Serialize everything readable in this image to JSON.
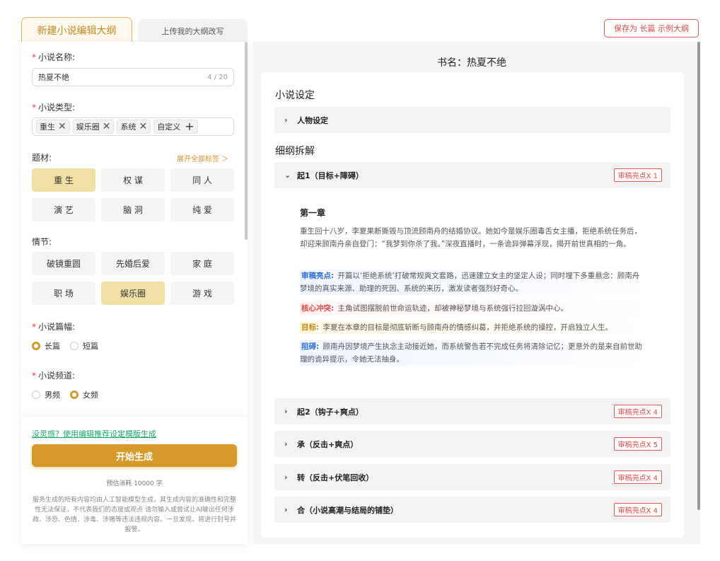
{
  "tabs": {
    "new": "新建小说编辑大纲",
    "upload": "上传我的大纲改写"
  },
  "save_button": "保存为 长篇 示例大纲",
  "form": {
    "name_label": "小说名称:",
    "name_value": "热夏不绝",
    "name_count": "4 / 20",
    "type_label": "小说类型:",
    "type_tags": [
      "重生",
      "娱乐圈",
      "系统"
    ],
    "custom_tag": "自定义",
    "theme_label": "题材:",
    "expand_label": "展开全部标签 ＞",
    "themes": [
      "重 生",
      "权 谋",
      "同 人",
      "演 艺",
      "脑 洞",
      "纯 爱"
    ],
    "plot_label": "情节:",
    "plots": [
      "破镜重圆",
      "先婚后爱",
      "家 庭",
      "职 场",
      "娱乐圈",
      "游 戏"
    ],
    "length_label": "小说篇幅:",
    "length_options": [
      "长篇",
      "短篇"
    ],
    "channel_label": "小说频道:",
    "channel_options": [
      "男频",
      "女频"
    ]
  },
  "bottom": {
    "inspire": "没灵感？使用编辑推荐设定模版生成",
    "generate": "开始生成",
    "cost": "预估消耗 10000 字",
    "disclaimer": "服务生成的所有内容均由人工智能模型生成，其生成内容的准确性和完整性无法保证，不代表我们的态度或观点 请勿输入或尝试让AI输出任何涉政、涉恐、色情、涉毒、涉赌等违法违规内容。一旦发现，将进行封号并报警。"
  },
  "right": {
    "book_title": "书名：热夏不绝",
    "settings_title": "小说设定",
    "character_row": "人物设定",
    "outline_title": "细纲拆解",
    "sections": [
      {
        "title": "起1（目标+障碍）",
        "badge": "审稿亮点X 1"
      },
      {
        "title": "起2（钩子+爽点）",
        "badge": "审稿亮点X 4"
      },
      {
        "title": "承（反击+爽点）",
        "badge": "审稿亮点X 5"
      },
      {
        "title": "转（反击+伏笔回收）",
        "badge": "审稿亮点X 4"
      },
      {
        "title": "合（小说高潮与结局的铺垫）",
        "badge": "审稿亮点X 4"
      }
    ],
    "chapter_title": "第一章",
    "chapter_summary": "重生回十八岁，李夏果断撕毁与顶流顾南舟的结婚协议。她如今是娱乐圈毒舌女主播，拒绝系统任务后，却迎来顾南舟亲自登门：“我梦到你杀了我。”深夜直播时，一条诡异弹幕浮现，揭开前世真相的一角。",
    "highlight_label": "审稿亮点:",
    "highlight_text": "开篇以‘拒绝系统’打破常规爽文套路，迅速建立女主的坚定人设；同时埋下多重悬念：顾南舟梦境的真实来源、助理的死因、系统的来历，激发读者强烈好奇心。",
    "conflict_label": "核心冲突:",
    "conflict_text": "主角试图摆脱前世命运轨迹，却被神秘梦境与系统强行拉回漩涡中心。",
    "goal_label": "目标:",
    "goal_text": "李夏在本章的目标是彻底斩断与顾南舟的情感纠葛，并拒绝系统的操控，开启独立人生。",
    "obstacle_label": "阻碍:",
    "obstacle_text": "顾南舟因梦境产生执念主动接近她，而系统警告若不完成任务将清除记忆；更意外的是来自前世助理的诡异提示，令她无法抽身。"
  }
}
